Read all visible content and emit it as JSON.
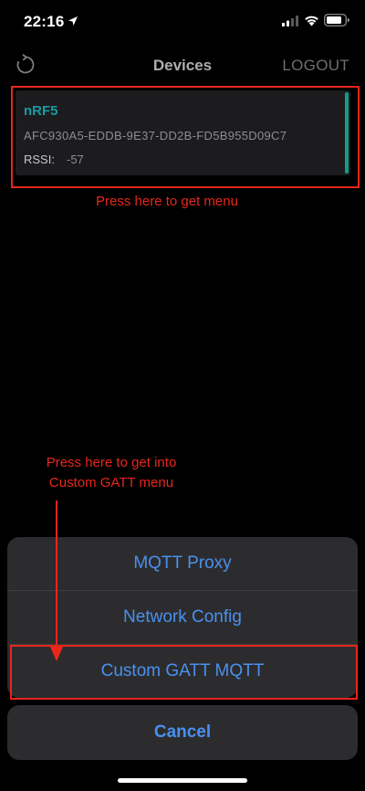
{
  "status_bar": {
    "time": "22:16",
    "icons": [
      "location-arrow-icon",
      "cellular-signal-icon",
      "wifi-icon",
      "battery-icon"
    ]
  },
  "nav": {
    "title": "Devices",
    "logout_label": "LOGOUT",
    "left_icon": "refresh-icon"
  },
  "device": {
    "name": "nRF5",
    "uuid": "AFC930A5-EDDB-9E37-DD2B-FD5B955D09C7",
    "rssi_label": "RSSI:",
    "rssi_value": "-57"
  },
  "annotations": {
    "card_hint": "Press here to get menu",
    "custom_hint_line1": "Press here to get into",
    "custom_hint_line2": "Custom GATT menu"
  },
  "action_sheet": {
    "items": [
      {
        "label": "MQTT Proxy"
      },
      {
        "label": "Network Config"
      },
      {
        "label": "Custom GATT MQTT"
      }
    ],
    "cancel_label": "Cancel"
  },
  "colors": {
    "background": "#000000",
    "accent_blue": "#4a90ef",
    "device_name": "#1a9aa6",
    "card_accent": "#149a8a",
    "annotation_red": "#e8261c",
    "sheet_bg": "#2c2c2e"
  }
}
